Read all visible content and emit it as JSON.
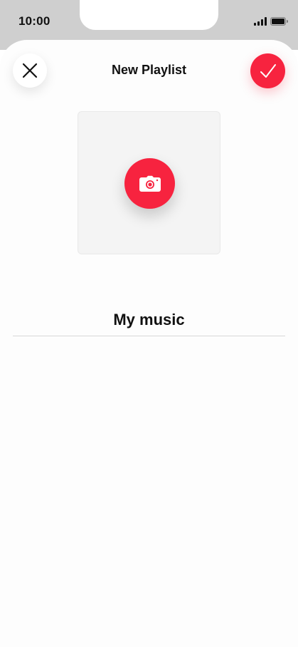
{
  "status_bar": {
    "time": "10:00",
    "signal_icon": "cellular-signal-icon",
    "battery_icon": "battery-icon"
  },
  "header": {
    "title": "New Playlist",
    "close_icon": "close-icon",
    "done_icon": "checkmark-icon"
  },
  "artwork": {
    "camera_icon": "camera-icon"
  },
  "playlist_name": {
    "value": "My music"
  },
  "colors": {
    "accent": "#f7233f",
    "status_bar_bg": "#cfcfcf",
    "sheet_bg": "#fdfdfd",
    "artwork_bg": "#f4f4f4"
  }
}
